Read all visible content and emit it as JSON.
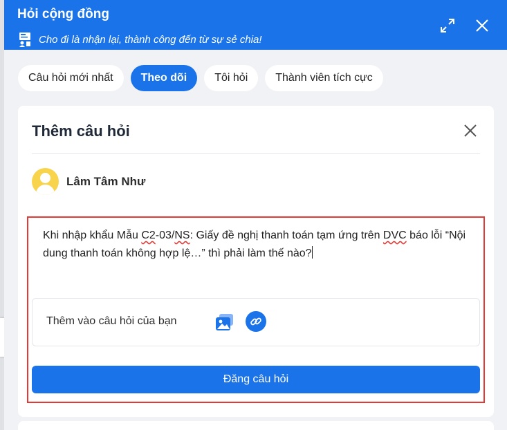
{
  "header": {
    "title": "Hỏi cộng đồng",
    "subtitle": "Cho đi là nhận lại, thành công đến từ sự sẻ chia!",
    "color": "#1a73e8"
  },
  "tabs": [
    {
      "label": "Câu hỏi mới nhất",
      "active": false
    },
    {
      "label": "Theo dõi",
      "active": true
    },
    {
      "label": "Tôi hỏi",
      "active": false
    },
    {
      "label": "Thành viên tích cực",
      "active": false
    }
  ],
  "form": {
    "title": "Thêm câu hỏi",
    "user_name": "Lâm Tâm Như",
    "question": {
      "p1": "Khi nhập khẩu Mẫu ",
      "w1": "C2",
      "p2": "-03/",
      "w2": "NS",
      "p3": ": Giấy đề nghị thanh toán tạm ứng trên ",
      "w3": "DVC",
      "p4": " báo lỗi “Nội dung thanh toán không hợp lệ…” thì phải làm thế nào?"
    },
    "add_label": "Thêm vào câu hỏi của bạn",
    "submit_label": "Đăng câu hỏi"
  },
  "icons": {
    "expand": "expand-icon",
    "close": "close-icon",
    "image": "image-icon",
    "link": "link-icon",
    "avatar": "user-avatar",
    "banner": "presentation-icon"
  },
  "colors": {
    "accent": "#1a73e8",
    "highlight_border": "#e53935",
    "avatar": "#f7d44c"
  }
}
